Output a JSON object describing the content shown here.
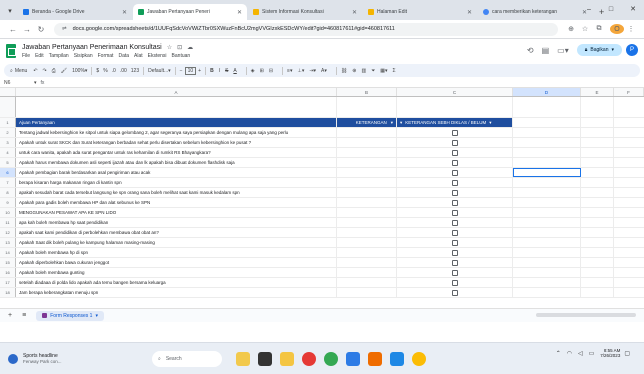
{
  "browser": {
    "tabs": [
      {
        "label": "Beranda - Google Drive",
        "active": false,
        "color": "#1a73e8"
      },
      {
        "label": "Jawaban Pertanyaan Peneri",
        "active": true,
        "color": "#0f9d58"
      },
      {
        "label": "Sistem Informasi Konsultasi",
        "active": false,
        "color": "#f4b400"
      },
      {
        "label": "Halaman Edit",
        "active": false,
        "color": "#f4b400"
      },
      {
        "label": "cara memberikan keterangan",
        "active": false,
        "color": "#4285f4"
      }
    ],
    "new_tab": "+",
    "url": "docs.google.com/spreadsheets/d/1UUFqSdcVoVWiZTbr0SXWuzFnBcU2mgVVGIzxkESDcWY/edit?gid=460817611#gid=460817611",
    "window": {
      "min": "–",
      "max": "□",
      "close": "✕"
    },
    "profile_initial": "O"
  },
  "doc": {
    "title": "Jawaban Pertanyaan Penerimaan Konsultasi",
    "menus": [
      "File",
      "Edit",
      "Tampilan",
      "Sisipkan",
      "Format",
      "Data",
      "Alat",
      "Ekstensi",
      "Bantuan"
    ],
    "share_label": "Bagikan",
    "avatar_initial": "P"
  },
  "toolbar": {
    "menus_label": "Menu",
    "zoom": "100%",
    "font": "Default...",
    "font_size": "10",
    "bold": "B",
    "italic": "I",
    "strike": "S",
    "text_a": "A"
  },
  "formula_bar": {
    "cell_ref": "N6",
    "fx": "fx"
  },
  "columns": [
    "A",
    "B",
    "C",
    "D",
    "E",
    "F"
  ],
  "header_row": {
    "a": "Ajuan Pertanyaan",
    "b": "KETERANGAN",
    "c": "KETERANGAN SEBH DIKLAS / BELUM"
  },
  "rows": [
    {
      "n": "2",
      "text": "Tentang jadwal kebersinghion ke sitpol untuk siapa gelombang 2, agar segeranya saya persiapkan dengan mulang apa saja yang perlu"
    },
    {
      "n": "3",
      "text": "Apakah untuk surat SKCK dan Surat keterangan berbadan sehat perlu disertakan sebelum kebersinghion ke pusat ?"
    },
    {
      "n": "4",
      "text": "untuk cara wanita, apakah ada surat pengantar untuk ras kehamilan di rumkit RS Bhayangkara?"
    },
    {
      "n": "5",
      "text": "Apakah harus membawa dokumen asli seperti ijazah atau dan lk apakah bisa dibuat dokumen flashdisk saja"
    },
    {
      "n": "6",
      "text": "Apakah pembagian barak berdasarkan asal pengiriman atau acak"
    },
    {
      "n": "7",
      "text": "berapa kisaran harga makanan ringan di kantin spn"
    },
    {
      "n": "8",
      "text": "apakah sesudah barat cada tersebut langsung ke spn orang sana boleh melihat saat kami masuk kedalam spn"
    },
    {
      "n": "9",
      "text": "Apakah para gadis boleh membawa HP dan alat sebunus ke SPN"
    },
    {
      "n": "10",
      "text": "MENGGUNAKAN PESAWAT APA KE SPN LIDO"
    },
    {
      "n": "11",
      "text": "apa kah boleh membawa hp saat pendidikan"
    },
    {
      "n": "12",
      "text": "apakah saat kami pendidikan di perbolehkan membawa obat obat an?"
    },
    {
      "n": "13",
      "text": "Apakah Saat dik boleh pulang ke kampung halaman masing-masing"
    },
    {
      "n": "14",
      "text": "Apakah boleh membawa hp di spn"
    },
    {
      "n": "15",
      "text": "Apakah diperbolehkan bawa cukuran jenggot"
    },
    {
      "n": "16",
      "text": "Apakah boleh membawa gunting"
    },
    {
      "n": "17",
      "text": "setelah diadaaa di polda lido apakah ada temu bangen bersama keluarga"
    },
    {
      "n": "18",
      "text": "Jam berapa keberangkatan menuju spn"
    }
  ],
  "sheet": {
    "add": "+",
    "list": "≡",
    "tab_label": "Form Responses 1"
  },
  "taskbar": {
    "news_title": "Sports headline",
    "news_sub": "Fenway Park con...",
    "search_label": "Search",
    "time": "8:55 AM",
    "date": "7/26/2023"
  }
}
